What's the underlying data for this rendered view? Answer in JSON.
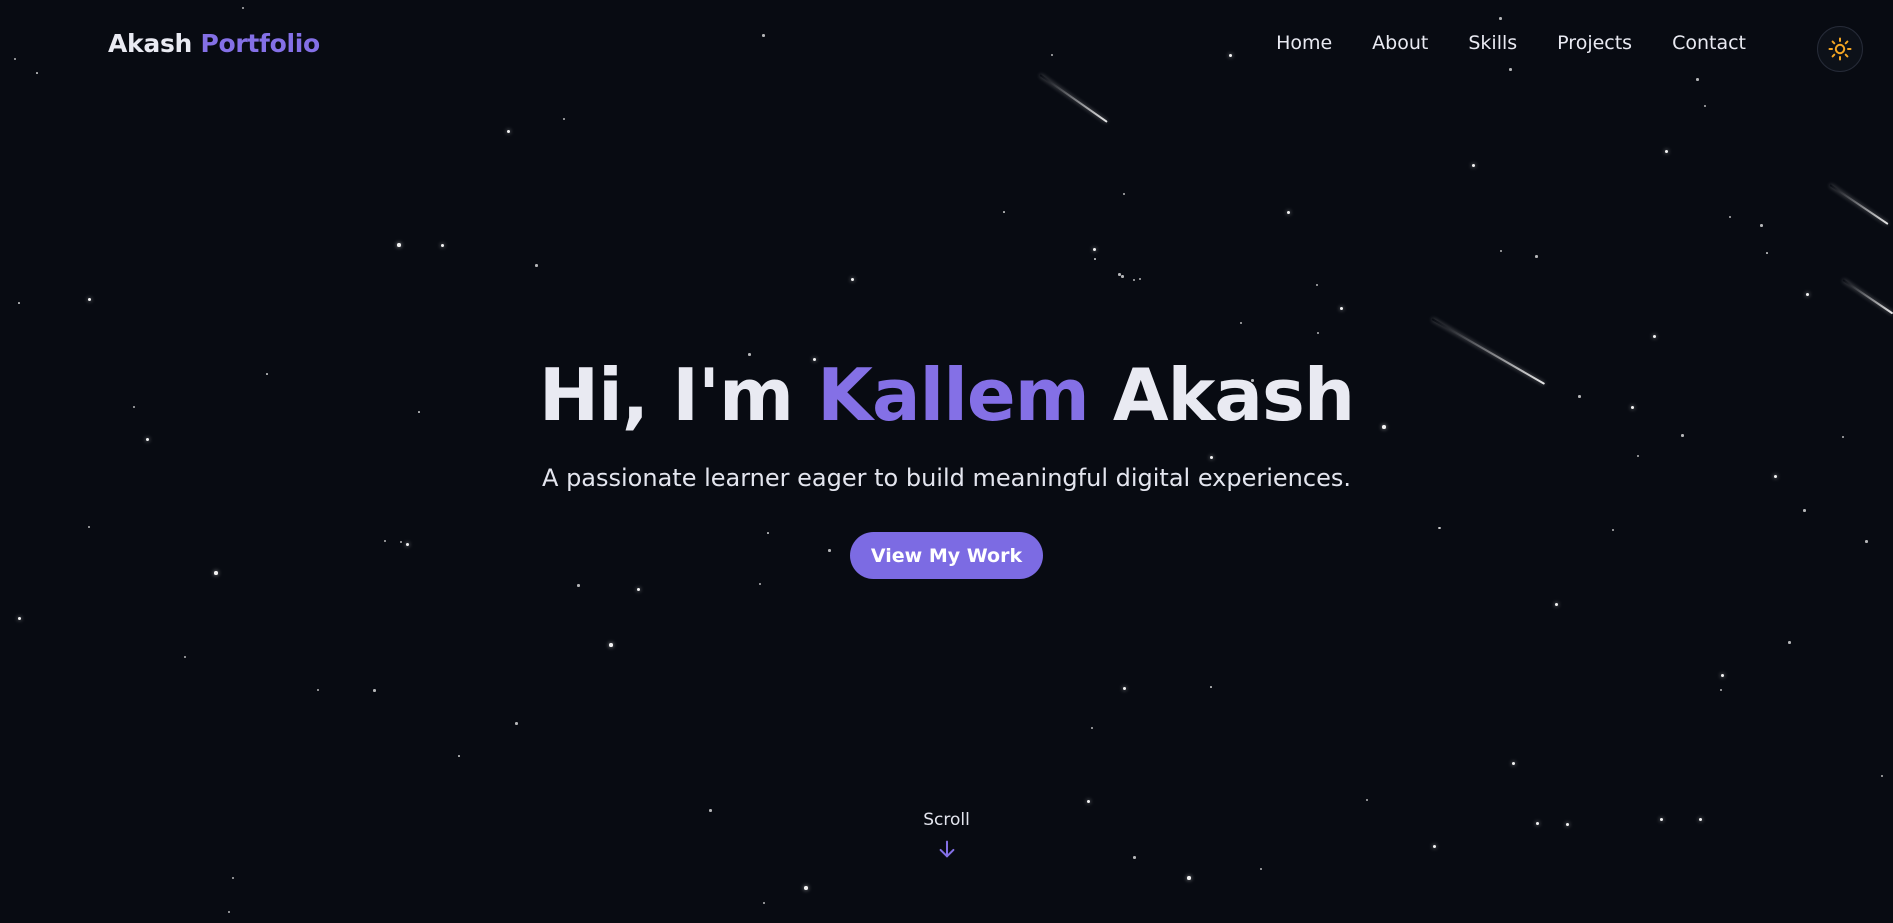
{
  "header": {
    "brand_first": "Akash",
    "brand_second": "Portfolio",
    "nav": [
      {
        "label": "Home"
      },
      {
        "label": "About"
      },
      {
        "label": "Skills"
      },
      {
        "label": "Projects"
      },
      {
        "label": "Contact"
      }
    ],
    "theme_toggle_icon": "sun-icon"
  },
  "hero": {
    "greeting": "Hi, I'm",
    "name_accent": "Kallem",
    "name_rest": "Akash",
    "tagline": "A passionate learner eager to build meaningful digital experiences.",
    "cta_label": "View My Work"
  },
  "scroll": {
    "label": "Scroll",
    "icon": "arrow-down-icon"
  },
  "colors": {
    "background": "#080b12",
    "accent": "#8470e6",
    "button": "#7c6be3",
    "text": "#e9eaf2",
    "sun": "#f5a623"
  }
}
